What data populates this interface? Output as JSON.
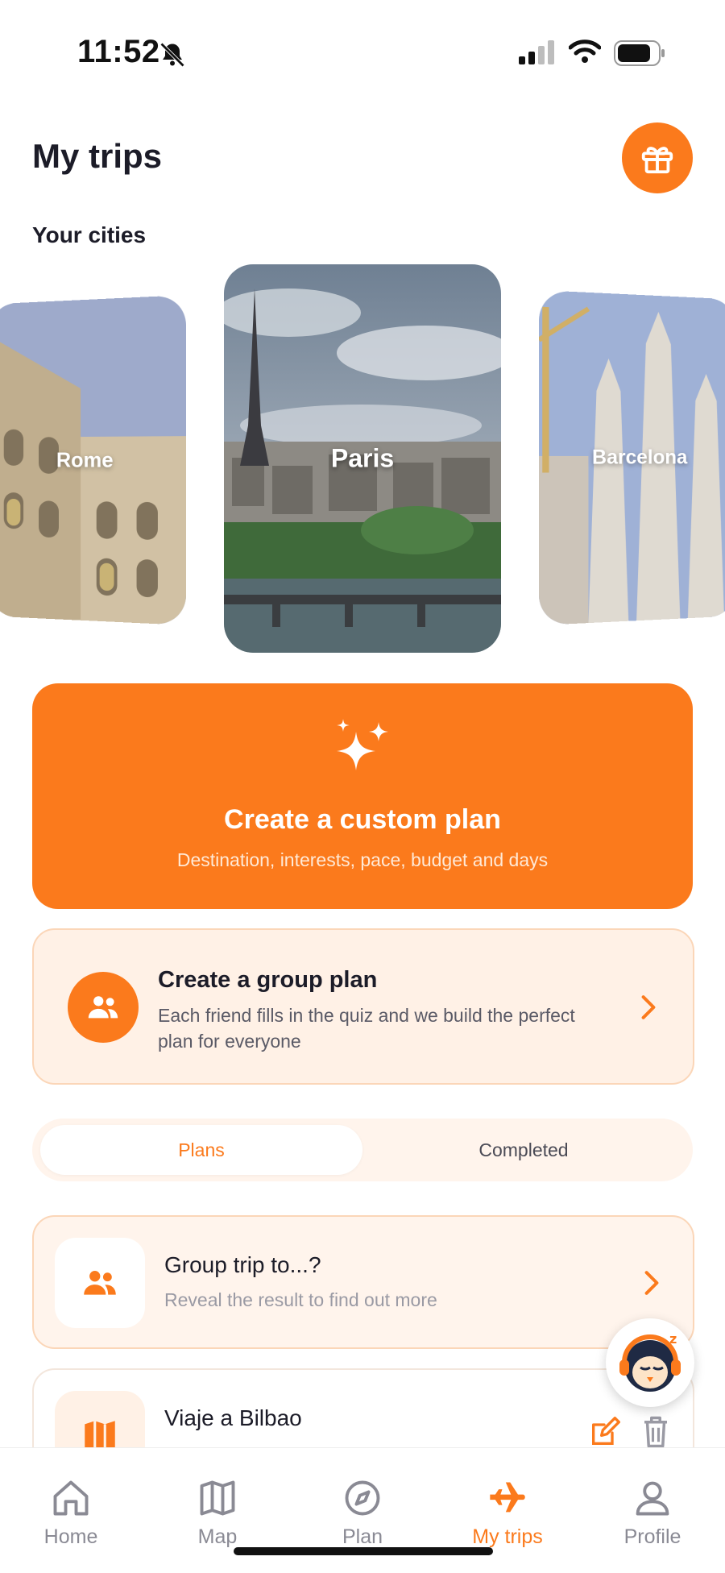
{
  "status_bar": {
    "time": "11:52"
  },
  "header": {
    "title": "My trips"
  },
  "cities_section": {
    "title": "Your cities",
    "cities": [
      {
        "name": "Rome"
      },
      {
        "name": "Paris"
      },
      {
        "name": "Barcelona"
      }
    ]
  },
  "custom_plan": {
    "title": "Create a custom plan",
    "subtitle": "Destination, interests, pace, budget and days"
  },
  "group_plan": {
    "title": "Create a group plan",
    "description": "Each friend fills in the quiz and we build the perfect plan for everyone"
  },
  "tabs": {
    "active": "Plans",
    "items": [
      "Plans",
      "Completed"
    ]
  },
  "trips": [
    {
      "title": "Group trip to...?",
      "subtitle": "Reveal the result to find out more"
    },
    {
      "title": "Viaje a Bilbao",
      "subtitle": ""
    }
  ],
  "bottom_nav": {
    "active": "My trips",
    "items": [
      "Home",
      "Map",
      "Plan",
      "My trips",
      "Profile"
    ]
  },
  "colors": {
    "accent": "#fb7a1c",
    "accent_light": "#fff1e6",
    "text": "#1c1c28"
  }
}
